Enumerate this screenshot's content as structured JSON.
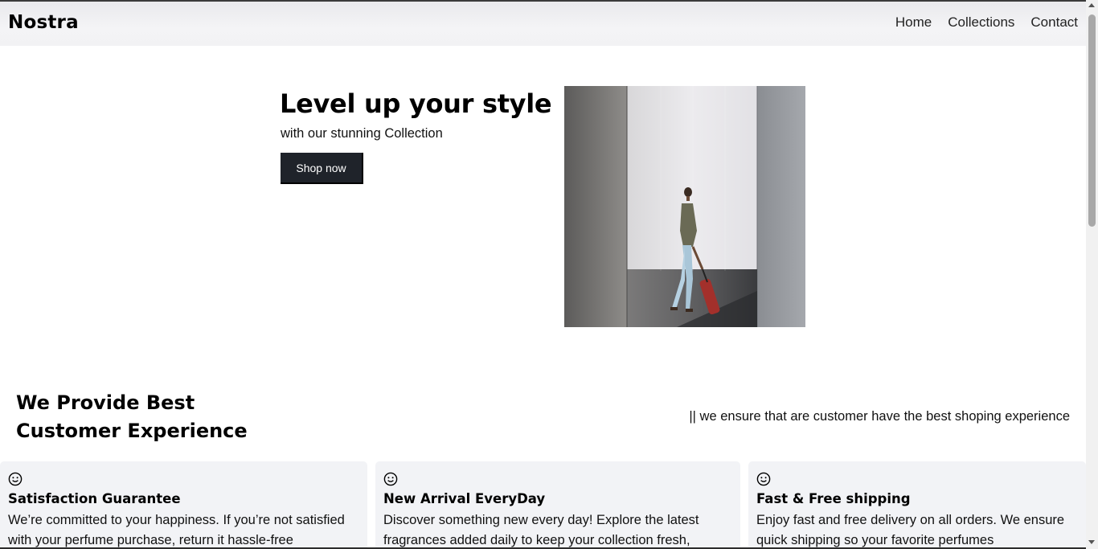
{
  "nav": {
    "brand": "Nostra",
    "links": [
      "Home",
      "Collections",
      "Contact"
    ]
  },
  "hero": {
    "title": "Level up your style",
    "subtitle": "with our stunning Collection",
    "cta_label": "Shop now"
  },
  "experience": {
    "title": "We Provide Best Customer Experience",
    "tagline": "|| we ensure that are customer have the best shoping experience"
  },
  "features": [
    {
      "icon": "smile-icon",
      "title": "Satisfaction Guarantee",
      "description": "We’re committed to your happiness. If you’re not satisfied with your perfume purchase, return it hassle-free"
    },
    {
      "icon": "smile-icon",
      "title": "New Arrival EveryDay",
      "description": "Discover something new every day! Explore the latest fragrances added daily to keep your collection fresh,"
    },
    {
      "icon": "smile-icon",
      "title": "Fast & Free shipping",
      "description": "Enjoy fast and free delivery on all orders. We ensure quick shipping so your favorite perfumes"
    }
  ],
  "colors": {
    "button_bg": "#1f232a",
    "card_bg": "#f2f3f6"
  }
}
